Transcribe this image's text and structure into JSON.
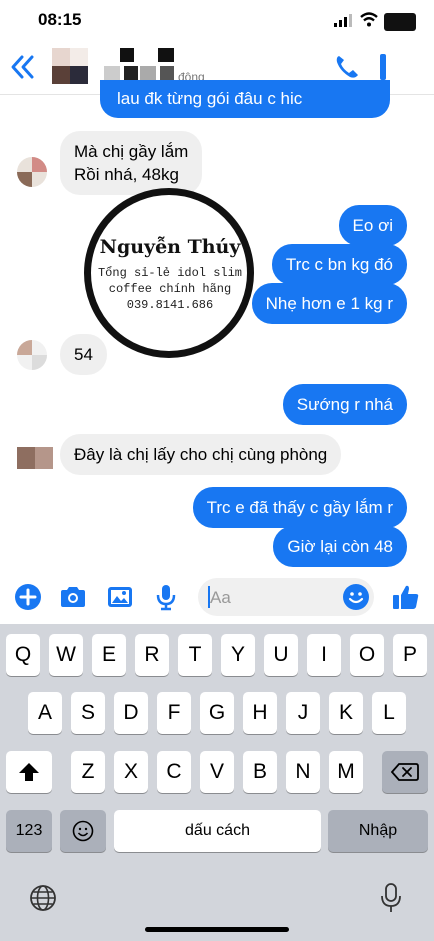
{
  "status_bar": {
    "time": "08:15"
  },
  "header": {
    "active_status_fragment": "động"
  },
  "messages": [
    {
      "side": "out",
      "text": "lau đk từng gói đâu c hic"
    },
    {
      "side": "in",
      "lines": [
        "Mà chị gầy lắm",
        "Rồi nhá, 48kg"
      ]
    },
    {
      "side": "out",
      "text": "Eo ơi"
    },
    {
      "side": "out",
      "text": "Trc c bn kg đó"
    },
    {
      "side": "out",
      "text": "Nhẹ hơn e 1 kg r"
    },
    {
      "side": "in",
      "text": "54"
    },
    {
      "side": "out",
      "text": "Sướng r nhá"
    },
    {
      "side": "in",
      "text": "Đây là chị lấy cho chị cùng phòng"
    },
    {
      "side": "out",
      "text": "Trc e đã thấy c gầy lắm r"
    },
    {
      "side": "out",
      "text": "Giờ lại còn 48"
    }
  ],
  "watermark": {
    "title": "Nguyễn Thúy",
    "line1": "Tổng sỉ-lẻ idol slim",
    "line2": "coffee chính hãng",
    "line3": "039.8141.686"
  },
  "composer": {
    "placeholder": "Aa"
  },
  "keyboard": {
    "row1": [
      "Q",
      "W",
      "E",
      "R",
      "T",
      "Y",
      "U",
      "I",
      "O",
      "P"
    ],
    "row2": [
      "A",
      "S",
      "D",
      "F",
      "G",
      "H",
      "J",
      "K",
      "L"
    ],
    "row3": [
      "Z",
      "X",
      "C",
      "V",
      "B",
      "N",
      "M"
    ],
    "numbers_key": "123",
    "space_key": "dấu cách",
    "return_key": "Nhập"
  },
  "colors": {
    "accent": "#1877f2",
    "incoming_bubble": "#efefef",
    "keyboard_bg": "#d2d5db"
  }
}
